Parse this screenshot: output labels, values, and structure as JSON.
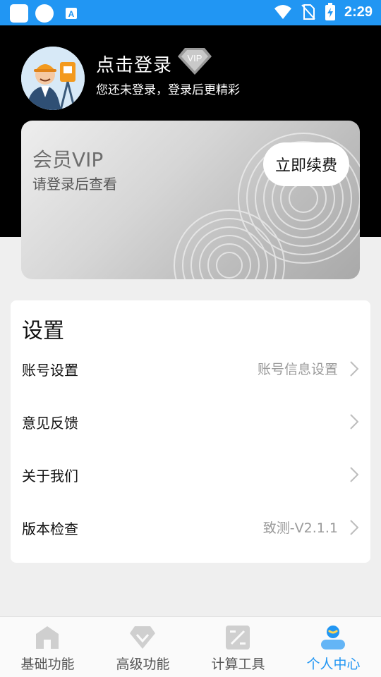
{
  "status_bar": {
    "time": "2:29",
    "color": "#2196f3"
  },
  "profile": {
    "login_title": "点击登录",
    "login_subtitle": "您还未登录，登录后更精彩",
    "vip_badge_text": "VIP"
  },
  "vip_card": {
    "title": "会员VIP",
    "subtitle": "请登录后查看",
    "renew_button": "立即续费"
  },
  "settings": {
    "title": "设置",
    "rows": [
      {
        "label": "账号设置",
        "value": "账号信息设置"
      },
      {
        "label": "意见反馈",
        "value": ""
      },
      {
        "label": "关于我们",
        "value": ""
      },
      {
        "label": "版本检查",
        "value": "致测-V2.1.1"
      }
    ]
  },
  "bottom_nav": {
    "items": [
      {
        "label": "基础功能",
        "icon": "home-icon"
      },
      {
        "label": "高级功能",
        "icon": "diamond-icon"
      },
      {
        "label": "计算工具",
        "icon": "calculator-icon"
      },
      {
        "label": "个人中心",
        "icon": "user-icon"
      }
    ],
    "active_index": 3,
    "active_color": "#2196f3"
  }
}
